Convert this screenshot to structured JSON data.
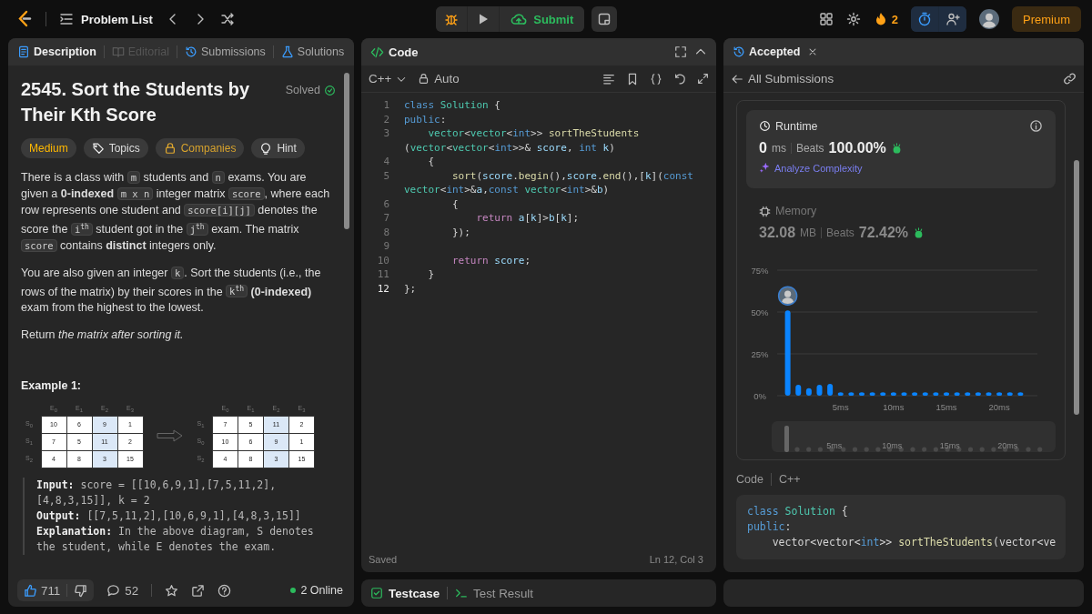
{
  "top_bar": {
    "problem_list": "Problem List",
    "submit": "Submit",
    "streak": "2",
    "premium": "Premium"
  },
  "description_panel": {
    "tabs": [
      {
        "label": "Description",
        "selected": true,
        "disabled": false
      },
      {
        "label": "Editorial",
        "selected": false,
        "disabled": true
      },
      {
        "label": "Submissions",
        "selected": false,
        "disabled": false
      },
      {
        "label": "Solutions",
        "selected": false,
        "disabled": false
      }
    ],
    "title": "2545. Sort the Students by Their Kth Score",
    "status": "Solved",
    "tags": [
      {
        "label": "Medium",
        "kind": "difficulty"
      },
      {
        "label": "Topics",
        "kind": "topics"
      },
      {
        "label": "Companies",
        "kind": "premium"
      },
      {
        "label": "Hint",
        "kind": "hint"
      }
    ],
    "paragraphs": [
      [
        {
          "kind": "text",
          "text": "There is a class with "
        },
        {
          "kind": "code",
          "text": "m"
        },
        {
          "kind": "text",
          "text": " students and "
        },
        {
          "kind": "code",
          "text": "n"
        },
        {
          "kind": "text",
          "text": " exams. You are given a **0-indexed** "
        },
        {
          "kind": "code",
          "text": "m x n"
        },
        {
          "kind": "text",
          "text": " integer matrix "
        },
        {
          "kind": "code",
          "text": "score"
        },
        {
          "kind": "text",
          "text": ", where each row represents one student and "
        },
        {
          "kind": "code",
          "text": "score[i][j]"
        },
        {
          "kind": "text",
          "text": " denotes the score the "
        },
        {
          "kind": "code",
          "text": "i$^{th}$"
        },
        {
          "kind": "text",
          "text": " student got in the "
        },
        {
          "kind": "code",
          "text": "j$^{th}$"
        },
        {
          "kind": "text",
          "text": " exam. The matrix "
        },
        {
          "kind": "code",
          "text": "score"
        },
        {
          "kind": "text",
          "text": " contains **distinct** integers only."
        }
      ],
      [
        {
          "kind": "text",
          "text": "You are also given an integer "
        },
        {
          "kind": "code",
          "text": "k"
        },
        {
          "kind": "text",
          "text": ". Sort the students (i.e., the rows of the matrix) by their scores in the "
        },
        {
          "kind": "code",
          "text": "k$^{th}$"
        },
        {
          "kind": "text",
          "text": " **(0-indexed)** exam from the highest to the lowest."
        }
      ],
      [
        {
          "kind": "text",
          "text": "Return *the matrix after sorting it.*"
        }
      ]
    ],
    "example": {
      "heading": "Example 1:",
      "tables": [
        {
          "row_labels": [
            "S$_{0}$",
            "S$_{1}$",
            "S$_{2}$"
          ],
          "columns": [
            {
              "label": "E$_{0}$",
              "highlighted": false
            },
            {
              "label": "E$_{1}$",
              "highlighted": false
            },
            {
              "label": "E$_{2}$",
              "highlighted": true
            },
            {
              "label": "E$_{3}$",
              "highlighted": false
            }
          ],
          "rows": [
            [
              "10",
              "6",
              "9",
              "1"
            ],
            [
              "7",
              "5",
              "11",
              "2"
            ],
            [
              "4",
              "8",
              "3",
              "15"
            ]
          ]
        },
        {
          "row_labels": [
            "S$_{1}$",
            "S$_{0}$",
            "S$_{2}$"
          ],
          "columns": [
            {
              "label": "E$_{0}$",
              "highlighted": false
            },
            {
              "label": "E$_{1}$",
              "highlighted": false
            },
            {
              "label": "E$_{2}$",
              "highlighted": true
            },
            {
              "label": "E$_{3}$",
              "highlighted": false
            }
          ],
          "rows": [
            [
              "7",
              "5",
              "11",
              "2"
            ],
            [
              "10",
              "6",
              "9",
              "1"
            ],
            [
              "4",
              "8",
              "3",
              "15"
            ]
          ]
        }
      ],
      "lines": [
        "**Input:** score = [[10,6,9,1],[7,5,11,2],[4,8,3,15]], k = 2",
        "**Output:** [[7,5,11,2],[10,6,9,1],[4,8,3,15]]",
        "**Explanation:** In the above diagram, S denotes the student, while E denotes the exam."
      ]
    },
    "footer": {
      "likes": "711",
      "comments": "52",
      "online": "2 Online"
    }
  },
  "code_panel": {
    "title": "Code",
    "language": "C++",
    "mode": "Auto",
    "lines": [
      {
        "number": "1",
        "current": false,
        "rows": [
          {
            "tokens": [
              {
                "kind": "kw",
                "text": "class"
              },
              {
                "kind": "type",
                "text": " Solution"
              },
              {
                "kind": "plain",
                "text": " {"
              }
            ]
          }
        ]
      },
      {
        "number": "2",
        "current": false,
        "rows": [
          {
            "tokens": [
              {
                "kind": "kw",
                "text": "public"
              },
              {
                "kind": "plain",
                "text": ":"
              }
            ]
          }
        ]
      },
      {
        "number": "3",
        "current": false,
        "rows": [
          {
            "tokens": [
              {
                "kind": "type",
                "text": "    vector"
              },
              {
                "kind": "plain",
                "text": "<"
              },
              {
                "kind": "type",
                "text": "vector"
              },
              {
                "kind": "plain",
                "text": "<"
              },
              {
                "kind": "kw",
                "text": "int"
              },
              {
                "kind": "plain",
                "text": ">> "
              },
              {
                "kind": "fn",
                "text": "sortTheStudents"
              }
            ]
          },
          {
            "tokens": [
              {
                "kind": "plain",
                "text": "("
              },
              {
                "kind": "type",
                "text": "vector"
              },
              {
                "kind": "plain",
                "text": "<"
              },
              {
                "kind": "type",
                "text": "vector"
              },
              {
                "kind": "plain",
                "text": "<"
              },
              {
                "kind": "kw",
                "text": "int"
              },
              {
                "kind": "plain",
                "text": ">>& "
              },
              {
                "kind": "var",
                "text": "score"
              },
              {
                "kind": "plain",
                "text": ", "
              },
              {
                "kind": "kw",
                "text": "int"
              },
              {
                "kind": "var",
                "text": " k"
              },
              {
                "kind": "plain",
                "text": ")"
              }
            ]
          }
        ]
      },
      {
        "number": "4",
        "current": false,
        "rows": [
          {
            "tokens": [
              {
                "kind": "plain",
                "text": "    {"
              }
            ]
          }
        ]
      },
      {
        "number": "5",
        "current": false,
        "rows": [
          {
            "tokens": [
              {
                "kind": "fn",
                "text": "        sort"
              },
              {
                "kind": "plain",
                "text": "("
              },
              {
                "kind": "var",
                "text": "score"
              },
              {
                "kind": "plain",
                "text": "."
              },
              {
                "kind": "fn",
                "text": "begin"
              },
              {
                "kind": "plain",
                "text": "(),"
              },
              {
                "kind": "var",
                "text": "score"
              },
              {
                "kind": "plain",
                "text": "."
              },
              {
                "kind": "fn",
                "text": "end"
              },
              {
                "kind": "plain",
                "text": "(),["
              },
              {
                "kind": "var",
                "text": "k"
              },
              {
                "kind": "plain",
                "text": "]("
              },
              {
                "kind": "kw",
                "text": "const"
              }
            ]
          },
          {
            "tokens": [
              {
                "kind": "type",
                "text": "vector"
              },
              {
                "kind": "plain",
                "text": "<"
              },
              {
                "kind": "kw",
                "text": "int"
              },
              {
                "kind": "plain",
                "text": ">&"
              },
              {
                "kind": "var",
                "text": "a"
              },
              {
                "kind": "plain",
                "text": ","
              },
              {
                "kind": "kw",
                "text": "const"
              },
              {
                "kind": "type",
                "text": " vector"
              },
              {
                "kind": "plain",
                "text": "<"
              },
              {
                "kind": "kw",
                "text": "int"
              },
              {
                "kind": "plain",
                "text": ">&"
              },
              {
                "kind": "var",
                "text": "b"
              },
              {
                "kind": "plain",
                "text": ")"
              }
            ]
          }
        ]
      },
      {
        "number": "6",
        "current": false,
        "rows": [
          {
            "tokens": [
              {
                "kind": "plain",
                "text": "        {"
              }
            ]
          }
        ]
      },
      {
        "number": "7",
        "current": false,
        "rows": [
          {
            "tokens": [
              {
                "kind": "ctrl",
                "text": "            return"
              },
              {
                "kind": "var",
                "text": " a"
              },
              {
                "kind": "plain",
                "text": "["
              },
              {
                "kind": "var",
                "text": "k"
              },
              {
                "kind": "plain",
                "text": "]>"
              },
              {
                "kind": "var",
                "text": "b"
              },
              {
                "kind": "plain",
                "text": "["
              },
              {
                "kind": "var",
                "text": "k"
              },
              {
                "kind": "plain",
                "text": "];"
              }
            ]
          }
        ]
      },
      {
        "number": "8",
        "current": false,
        "rows": [
          {
            "tokens": [
              {
                "kind": "plain",
                "text": "        });"
              }
            ]
          }
        ]
      },
      {
        "number": "9",
        "current": false
      },
      {
        "number": "10",
        "current": false,
        "rows": [
          {
            "tokens": [
              {
                "kind": "ctrl",
                "text": "        return"
              },
              {
                "kind": "var",
                "text": " score"
              },
              {
                "kind": "plain",
                "text": ";"
              }
            ]
          }
        ]
      },
      {
        "number": "11",
        "current": false,
        "rows": [
          {
            "tokens": [
              {
                "kind": "plain",
                "text": "    }"
              }
            ]
          }
        ]
      },
      {
        "number": "12",
        "current": true,
        "rows": [
          {
            "tokens": [
              {
                "kind": "plain",
                "text": "};"
              }
            ]
          }
        ]
      }
    ],
    "status": "Saved",
    "cursor": "Ln 12, Col 3"
  },
  "testcase_bar": {
    "tabs": [
      {
        "label": "Testcase",
        "selected": true
      },
      {
        "label": "Test Result",
        "selected": false
      }
    ]
  },
  "result_panel": {
    "tab": "Accepted",
    "back_link": "All Submissions",
    "metrics": [
      {
        "kind": "runtime",
        "label": "Runtime",
        "value": "0",
        "unit": "ms",
        "beats_label": "Beats",
        "beats": "100.00%",
        "selected": true,
        "action": "Analyze Complexity"
      },
      {
        "kind": "memory",
        "label": "Memory",
        "value": "32.08",
        "unit": "MB",
        "beats_label": "Beats",
        "beats": "72.42%",
        "selected": false
      }
    ],
    "chart_data": {
      "type": "bar",
      "x": [
        0,
        1,
        2,
        3,
        4,
        5,
        6,
        7,
        8,
        9,
        10,
        11,
        12,
        13,
        14,
        15,
        16,
        17,
        18,
        19,
        20,
        21,
        22
      ],
      "values": [
        51,
        6.5,
        4.5,
        6.5,
        7,
        2,
        2,
        2,
        2,
        2,
        2,
        2,
        2,
        2,
        2,
        2,
        2,
        2,
        2,
        2,
        2,
        2,
        2
      ],
      "ylim": [
        0,
        75
      ],
      "xlim": [
        -1,
        23.6
      ],
      "yticks": [
        {
          "value": 0,
          "label": "0%"
        },
        {
          "value": 25,
          "label": "25%"
        },
        {
          "value": 50,
          "label": "50%"
        },
        {
          "value": 75,
          "label": "75%"
        }
      ],
      "xticks": [
        {
          "value": 5,
          "label": "5ms"
        },
        {
          "value": 10,
          "label": "10ms"
        },
        {
          "value": 15,
          "label": "15ms"
        },
        {
          "value": 20,
          "label": "20ms"
        }
      ]
    },
    "overview": {
      "labels": [
        "5ms",
        "10ms",
        "15ms",
        "20ms"
      ]
    },
    "code_heading": "Code",
    "code_language": "C++",
    "code_lines": [
      {
        "tokens": [
          {
            "kind": "kw",
            "text": "class"
          },
          {
            "kind": "type",
            "text": " Solution"
          },
          {
            "kind": "plain",
            "text": " {"
          }
        ]
      },
      {
        "tokens": [
          {
            "kind": "kw",
            "text": "public"
          },
          {
            "kind": "plain",
            "text": ":"
          }
        ]
      },
      {
        "tokens": [
          {
            "kind": "plain",
            "text": "    vector<vector<"
          },
          {
            "kind": "kw",
            "text": "int"
          },
          {
            "kind": "plain",
            "text": ">> "
          },
          {
            "kind": "fn",
            "text": "sortTheStudents"
          },
          {
            "kind": "plain",
            "text": "(vector<ve"
          }
        ]
      }
    ]
  }
}
